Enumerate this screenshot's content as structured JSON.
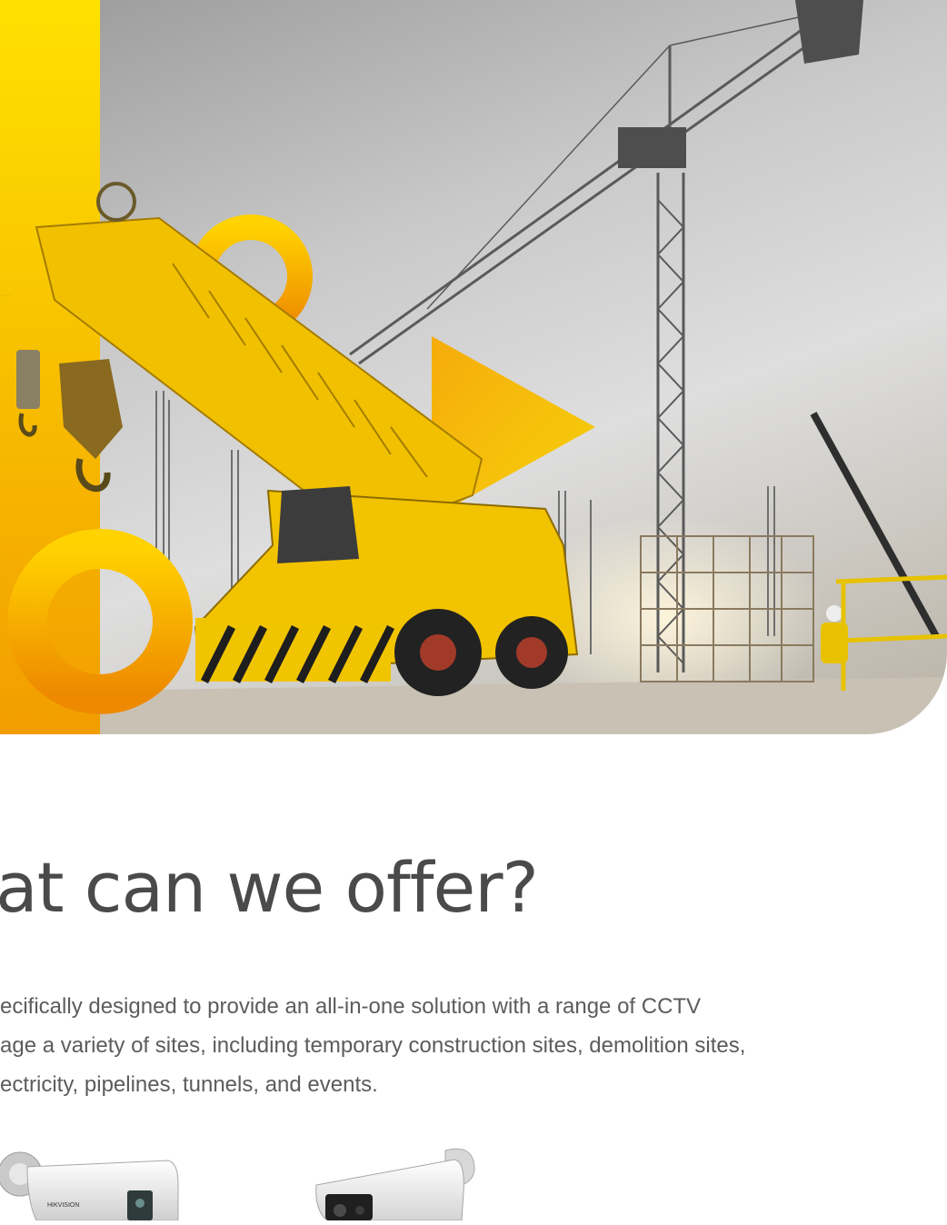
{
  "hero": {
    "image_subject": "construction-site-crane-photo",
    "accent_colors": [
      "#ffe100",
      "#f8c300",
      "#f29d00"
    ]
  },
  "section": {
    "heading": "hat can we offer?",
    "description_lines": [
      "ecifically designed to provide an all-in-one solution with a range of CCTV",
      "age a variety of sites, including temporary construction sites, demolition sites,",
      "ectricity, pipelines, tunnels, and events."
    ]
  },
  "products": [
    {
      "name": "bullet-camera-icon",
      "label": "HIKVISION"
    },
    {
      "name": "bullet-camera-icon"
    }
  ]
}
